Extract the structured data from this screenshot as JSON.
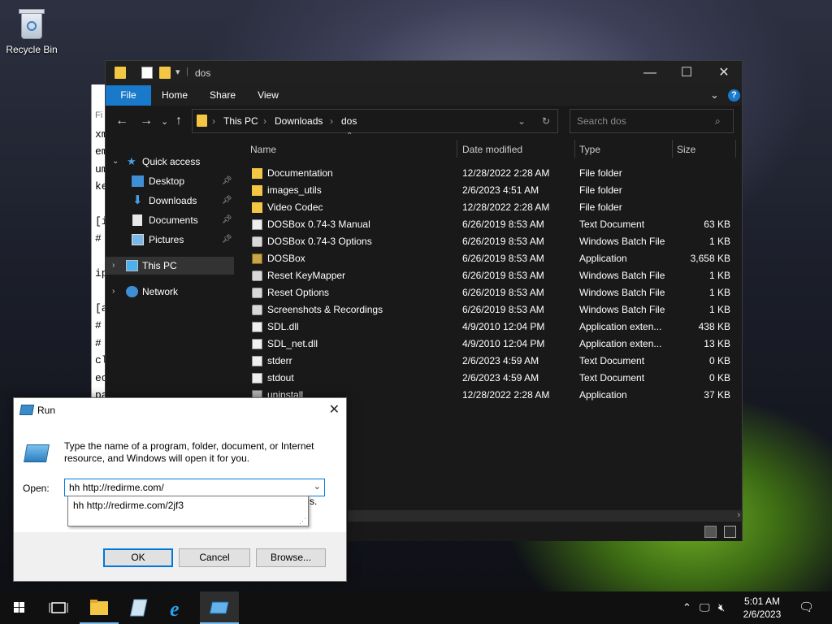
{
  "desktop": {
    "recycle_bin_label": "Recycle Bin"
  },
  "notepad": {
    "header_fragment": "Fi",
    "lines": [
      "xm",
      "em",
      "um",
      "ke",
      "",
      "[i",
      "#",
      "",
      "ip",
      "",
      "[a",
      "#",
      "#",
      "cl",
      "ec",
      "pa",
      "cl",
      "im",
      "cc"
    ]
  },
  "explorer": {
    "title": "dos",
    "ribbon_tabs": [
      "File",
      "Home",
      "Share",
      "View"
    ],
    "breadcrumb": [
      "This PC",
      "Downloads",
      "dos"
    ],
    "search_placeholder": "Search dos",
    "nav_pane": {
      "quick_access": "Quick access",
      "items": [
        "Desktop",
        "Downloads",
        "Documents",
        "Pictures"
      ],
      "this_pc": "This PC",
      "network": "Network"
    },
    "columns": [
      "Name",
      "Date modified",
      "Type",
      "Size"
    ],
    "files": [
      {
        "name": "Documentation",
        "date": "12/28/2022 2:28 AM",
        "type": "File folder",
        "size": "",
        "icon": "folder"
      },
      {
        "name": "images_utils",
        "date": "2/6/2023 4:51 AM",
        "type": "File folder",
        "size": "",
        "icon": "folder"
      },
      {
        "name": "Video Codec",
        "date": "12/28/2022 2:28 AM",
        "type": "File folder",
        "size": "",
        "icon": "folder"
      },
      {
        "name": "DOSBox 0.74-3 Manual",
        "date": "6/26/2019 8:53 AM",
        "type": "Text Document",
        "size": "63 KB",
        "icon": "doc"
      },
      {
        "name": "DOSBox 0.74-3 Options",
        "date": "6/26/2019 8:53 AM",
        "type": "Windows Batch File",
        "size": "1 KB",
        "icon": "bat"
      },
      {
        "name": "DOSBox",
        "date": "6/26/2019 8:53 AM",
        "type": "Application",
        "size": "3,658 KB",
        "icon": "app"
      },
      {
        "name": "Reset KeyMapper",
        "date": "6/26/2019 8:53 AM",
        "type": "Windows Batch File",
        "size": "1 KB",
        "icon": "bat"
      },
      {
        "name": "Reset Options",
        "date": "6/26/2019 8:53 AM",
        "type": "Windows Batch File",
        "size": "1 KB",
        "icon": "bat"
      },
      {
        "name": "Screenshots & Recordings",
        "date": "6/26/2019 8:53 AM",
        "type": "Windows Batch File",
        "size": "1 KB",
        "icon": "bat"
      },
      {
        "name": "SDL.dll",
        "date": "4/9/2010 12:04 PM",
        "type": "Application exten...",
        "size": "438 KB",
        "icon": "dll"
      },
      {
        "name": "SDL_net.dll",
        "date": "4/9/2010 12:04 PM",
        "type": "Application exten...",
        "size": "13 KB",
        "icon": "dll"
      },
      {
        "name": "stderr",
        "date": "2/6/2023 4:59 AM",
        "type": "Text Document",
        "size": "0 KB",
        "icon": "doc"
      },
      {
        "name": "stdout",
        "date": "2/6/2023 4:59 AM",
        "type": "Text Document",
        "size": "0 KB",
        "icon": "doc"
      },
      {
        "name": "uninstall",
        "date": "12/28/2022 2:28 AM",
        "type": "Application",
        "size": "37 KB",
        "icon": "setup"
      }
    ]
  },
  "run_dialog": {
    "title": "Run",
    "message": "Type the name of a program, folder, document, or Internet resource, and Windows will open it for you.",
    "open_label": "Open:",
    "open_value": "hh http://redirme.com/",
    "autocomplete": "hh http://redirme.com/2jf3",
    "hidden_fragment": "s.",
    "ok": "OK",
    "cancel": "Cancel",
    "browse": "Browse..."
  },
  "taskbar": {
    "time": "5:01 AM",
    "date": "2/6/2023"
  },
  "colors": {
    "accent": "#0078d7",
    "file_tab": "#1979ca"
  }
}
